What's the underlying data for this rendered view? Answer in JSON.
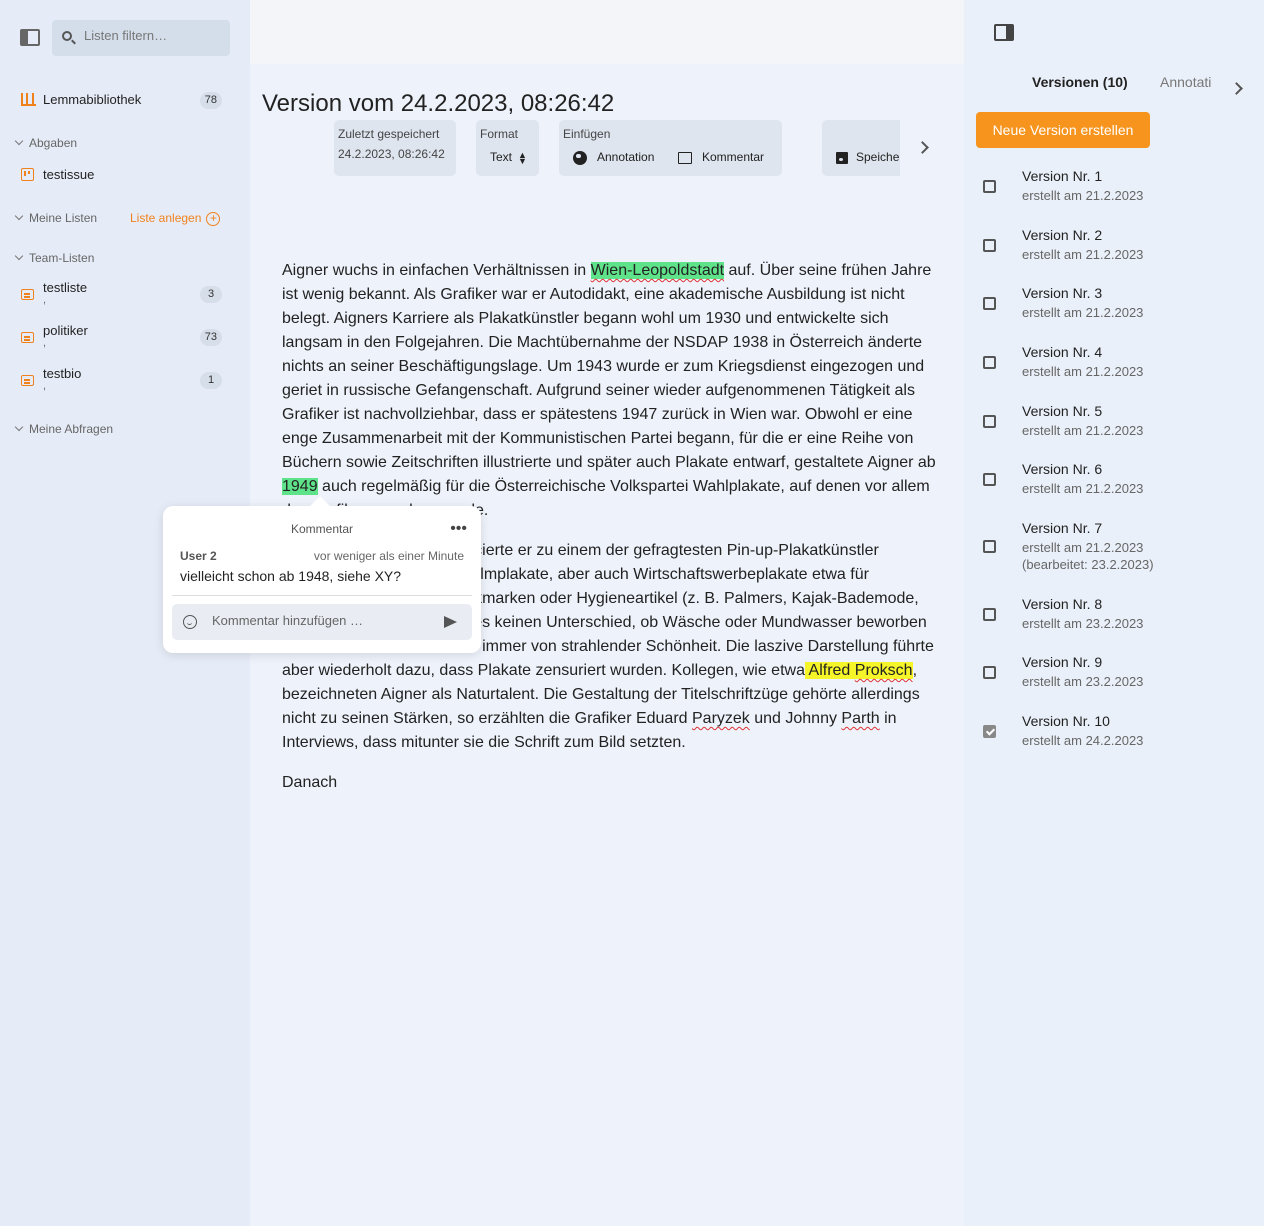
{
  "sidebar": {
    "search_placeholder": "Listen filtern…",
    "library": {
      "label": "Lemmabibliothek",
      "count": "78"
    },
    "sections": {
      "abgaben": "Abgaben",
      "meine_listen": "Meine Listen",
      "liste_anlegen": "Liste anlegen",
      "team_listen": "Team-Listen",
      "meine_abfragen": "Meine Abfragen"
    },
    "abgaben_items": [
      {
        "label": "testissue"
      }
    ],
    "team_lists": [
      {
        "label": "testliste",
        "sub": ",",
        "count": "3"
      },
      {
        "label": "politiker",
        "sub": ",",
        "count": "73"
      },
      {
        "label": "testbio",
        "sub": ",",
        "count": "1"
      }
    ]
  },
  "editor": {
    "title": "Version vom 24.2.2023, 08:26:42",
    "toolbar": {
      "saved_label": "Zuletzt gespeichert",
      "saved_value": "24.2.2023, 08:26:42",
      "format_label": "Format",
      "format_value": "Text",
      "insert_label": "Einfügen",
      "annotation_label": "Annotation",
      "comment_label": "Kommentar",
      "save_label": "Speiche"
    },
    "paragraph1": {
      "t1": "Aigner wuchs in einfachen Verhältnissen in ",
      "h1": "Wien-Leopoldstadt",
      "t2": " auf. Über seine frühen Jahre ist wenig bekannt. Als Grafiker war er Autodidakt, eine akademische Ausbildung ist nicht belegt. Aigners Karriere als Plakatkünstler begann wohl um 1930 und entwickelte sich langsam in den Folgejahren. Die Machtübernahme der NSDAP 1938 in Österreich änderte nichts an seiner Beschäftigungslage. Um 1943 wurde er zum Kriegsdienst eingezogen und geriet in russische Gefangenschaft. Aufgrund seiner wieder aufgenommenen Tätigkeit als Grafiker ist nachvollziehbar, dass er spätestens 1947 zurück in Wien war. Obwohl er eine enge Zusammenarbeit mit der Kommunistischen Partei begann, für die er eine Reihe von Büchern sowie Zeitschriften illustrierte und später auch Plakate entwarf, gestaltete Aigner ab ",
      "h2": "1949",
      "t3": " auch regelmäßig für die Österreichische Volkspartei Wahlplakate, auf denen vor allem der Grafiker zu sehen wurde."
    },
    "paragraph2": {
      "t1": "In den 1950er-Jahren avancierte er zu einem der gefragtesten Pin-up-Plakatkünstler Österreichs. Er gestaltete Filmplakate, aber auch Wirtschaftswerbeplakate etwa für Zigarettenmarken, Kosmetikmarken oder Hygieneartikel (z. B. Palmers, Kajak-Bademode, Drei Pfeile). Dabei machte es keinen Unterschied, ob Wäsche oder Mundwasser beworben wurde — seine Frauen sind immer von strahlender Schönheit. Die laszive Darstellung führte aber wiederholt dazu, dass Plakate zensuriert wurden. Kollegen, wie etwa",
      "h1": " Alfred ",
      "h1b": "Proksch",
      "t2": ", bezeichneten Aigner als Naturtalent. Die Gestaltung der Titelschriftzüge gehörte allerdings nicht zu seinen Stärken, so erzählten die Grafiker Eduard ",
      "w1": "Paryzek",
      "t3": " und Johnny ",
      "w2": "Parth",
      "t4": " in Interviews, dass mitunter sie die Schrift zum Bild setzten."
    },
    "paragraph3": "Danach"
  },
  "comment_popup": {
    "title": "Kommentar",
    "more_icon": "•••",
    "user": "User 2",
    "time": "vor weniger als einer Minute",
    "text": "vielleicht schon ab 1948, siehe XY?",
    "input_placeholder": "Kommentar hinzufügen …"
  },
  "right_panel": {
    "tab_versions": "Versionen (10)",
    "tab_annotations": "Annotati",
    "new_version_button": "Neue Version erstellen",
    "versions": [
      {
        "title": "Version Nr. 1",
        "date": "erstellt am 21.2.2023",
        "checked": false
      },
      {
        "title": "Version Nr. 2",
        "date": "erstellt am 21.2.2023",
        "checked": false
      },
      {
        "title": "Version Nr. 3",
        "date": "erstellt am 21.2.2023",
        "checked": false
      },
      {
        "title": "Version Nr. 4",
        "date": "erstellt am 21.2.2023",
        "checked": false
      },
      {
        "title": "Version Nr. 5",
        "date": "erstellt am 21.2.2023",
        "checked": false
      },
      {
        "title": "Version Nr. 6",
        "date": "erstellt am 21.2.2023",
        "checked": false
      },
      {
        "title": "Version Nr. 7",
        "date": "erstellt am 21.2.2023",
        "edited": "(bearbeitet: 23.2.2023)",
        "checked": false
      },
      {
        "title": "Version Nr. 8",
        "date": "erstellt am 23.2.2023",
        "checked": false
      },
      {
        "title": "Version Nr. 9",
        "date": "erstellt am 23.2.2023",
        "checked": false
      },
      {
        "title": "Version Nr. 10",
        "date": "erstellt am 24.2.2023",
        "checked": true
      }
    ]
  },
  "colors": {
    "accent": "#f7941d",
    "highlight_green": "#5fe38a",
    "highlight_yellow": "#f6f52a"
  }
}
